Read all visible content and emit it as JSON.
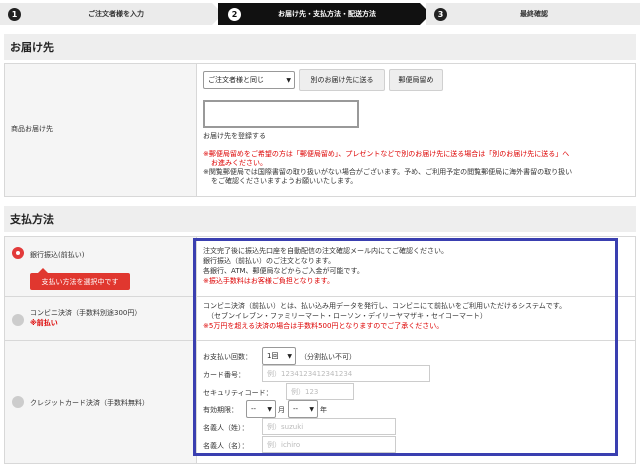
{
  "steps": [
    {
      "num": "1",
      "label": "ご注文者様を入力"
    },
    {
      "num": "2",
      "label": "お届け先・支払方法・配送方法"
    },
    {
      "num": "3",
      "label": "最終確認"
    }
  ],
  "delivery": {
    "title": "お届け先",
    "row_label": "商品お届け先",
    "select_value": "ご注文者様と同じ",
    "other_button": "別のお届け先に送る",
    "post_button": "郵便局留め",
    "register_text": "お届け先を登録する",
    "note1": "※郵便局留めをご希望の方は「郵便局留め」、プレゼントなどで別のお届け先に送る場合は「別のお届け先に送る」へ",
    "note1b": "お進みください。",
    "note2": "※関覧郵便局では国際書留の取り扱いがない場合がございます。予め、ご利用予定の閲覧郵便局に海外書留の取り扱い",
    "note2b": "をご確認くださいますようお願いいたします。"
  },
  "payment": {
    "title": "支払方法",
    "bank": {
      "label": "銀行振込(前払い)",
      "tooltip": "支払い方法を選択中です",
      "desc1": "注文完了後に振込先口座を自動配信の注文確認メール内にてご確認ください。",
      "desc2": "銀行振込（前払い）のご注文となります。",
      "desc3": "各銀行、ATM、郵便局などからご入金が可能です。",
      "desc4": "※振込手数料はお客様ご負担となります。"
    },
    "conveni": {
      "label": "コンビニ決済（手数料別途300円）",
      "sub": "※前払い",
      "desc1": "コンビニ決済（前払い）とは、払い込み用データを発行し、コンビニにて前払いをご利用いただけるシステムです。",
      "desc2": "（セブンイレブン・ファミリーマート・ローソン・デイリーヤマザキ・セイコーマート）",
      "desc3": "※5万円を超える決済の場合は手数料500円となりますのでご了承ください。"
    },
    "card": {
      "label": "クレジットカード決済（手数料無料）",
      "installments_label": "お支払い回数：",
      "installments_value": "1回",
      "installments_note": "（分割払い不可）",
      "card_number_label": "カード番号：",
      "card_number_placeholder": "例）1234123412341234",
      "security_label": "セキュリティコード：",
      "security_placeholder": "例）123",
      "expiry_label": "有効期限：",
      "expiry_month": "--",
      "month_unit": "月",
      "expiry_year": "--",
      "year_unit": "年",
      "last_name_label": "名義人（姓）：",
      "last_name_placeholder": "例）suzuki",
      "first_name_label": "名義人（名）：",
      "first_name_placeholder": "例）ichiro"
    }
  }
}
